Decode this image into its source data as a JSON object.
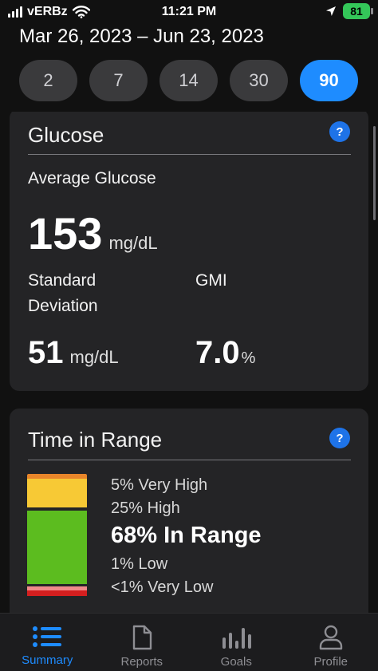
{
  "status_bar": {
    "carrier": "vERBz",
    "time": "11:21 PM",
    "battery": "81",
    "icons": [
      "signal-icon",
      "wifi-icon",
      "location-icon",
      "battery-icon"
    ]
  },
  "header": {
    "date_range": "Mar 26, 2023 – Jun 23, 2023",
    "period_options": [
      "2",
      "7",
      "14",
      "30",
      "90"
    ],
    "selected_period": "90"
  },
  "glucose_card": {
    "title": "Glucose",
    "help": "?",
    "avg_label": "Average Glucose",
    "avg_value": "153",
    "avg_unit": "mg/dL",
    "sd_label_line1": "Standard",
    "sd_label_line2": "Deviation",
    "sd_value": "51",
    "sd_unit": "mg/dL",
    "gmi_label": "GMI",
    "gmi_value": "7.0",
    "gmi_unit": "%"
  },
  "tir_card": {
    "title": "Time in Range",
    "help": "?",
    "very_high": "5% Very High",
    "high": "25% High",
    "in_range": "68% In Range",
    "low": "1% Low",
    "very_low": "<1% Very Low",
    "colors": {
      "very_high": "#e8852a",
      "high": "#f7c935",
      "in_range": "#5cbc1f",
      "low": "#f08a8a",
      "very_low": "#d41f1f"
    }
  },
  "tab_bar": {
    "tabs": [
      {
        "label": "Summary",
        "icon": "list-icon",
        "active": true
      },
      {
        "label": "Reports",
        "icon": "document-icon",
        "active": false
      },
      {
        "label": "Goals",
        "icon": "bar-chart-icon",
        "active": false
      },
      {
        "label": "Profile",
        "icon": "person-icon",
        "active": false
      }
    ]
  }
}
